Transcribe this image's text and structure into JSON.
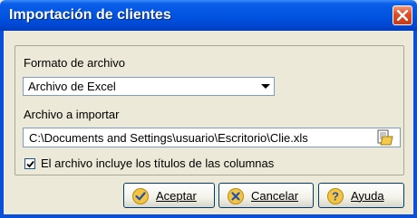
{
  "window": {
    "title": "Importación de clientes"
  },
  "format": {
    "label": "Formato de archivo",
    "selected": "Archivo de Excel"
  },
  "file": {
    "label": "Archivo a importar",
    "path": "C:\\Documents and Settings\\usuario\\Escritorio\\Clie.xls"
  },
  "options": {
    "include_titles_label": "El archivo incluye los títulos de las columnas",
    "include_titles_checked": true
  },
  "buttons": {
    "accept": "Aceptar",
    "cancel": "Cancelar",
    "help": "Ayuda"
  },
  "icons": {
    "close": "close-icon",
    "browse": "folder-browse-icon",
    "accept": "check-icon",
    "cancel": "x-icon",
    "help": "question-icon"
  },
  "colors": {
    "title_bar": "#0052e0",
    "close_button": "#e0502a",
    "dialog_bg": "#ece9d8"
  }
}
